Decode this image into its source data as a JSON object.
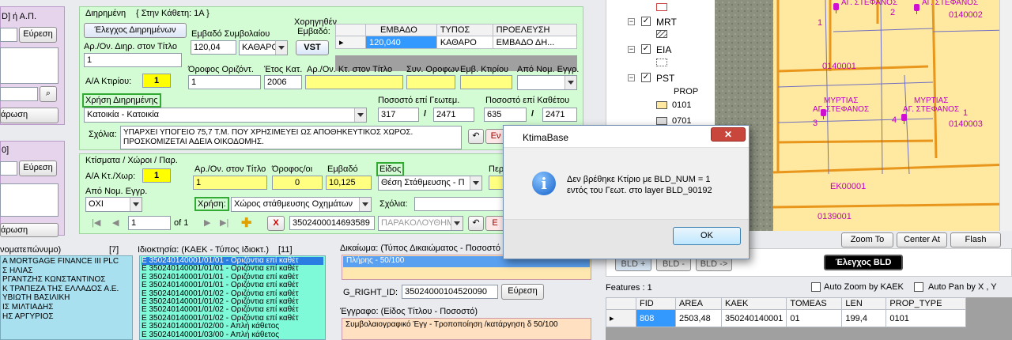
{
  "left": {
    "top_label": "D] ή Α.Π.",
    "search1": "Εύρεση",
    "apply1": "άρωση",
    "bracket": "0]",
    "search2": "Εύρεση",
    "apply2": "άρωση",
    "owners_header": "νοματεπώνυμο)",
    "owners_count": "[7]",
    "owners": [
      "A MORTGAGE FINANCE III PLC",
      "Σ ΗΛΙΑΣ",
      "ΡΓΑΝΤΖΗΣ ΚΩΝΣΤΑΝΤΙΝΟΣ",
      "Κ ΤΡΑΠΕΖΑ ΤΗΣ ΕΛΛΑΔΟΣ Α.Ε.",
      "ΥΒΙΩΤΗ ΒΑΣΙΛΙΚΗ",
      "ΙΣ ΜΙΛΤΙΑΔΗΣ",
      "ΗΣ ΑΡΓΥΡΙΟΣ"
    ]
  },
  "dir": {
    "title": "Διηρημένη",
    "subtitle": "{ Στην Κάθετη: 1Α }",
    "check_btn": "Έλεγχος Διηρημένων",
    "num_label": "Αρ./Ον. Διηρ. στον Τίτλο",
    "num_value": "1",
    "area_label": "Εμβαδό Συμβολαίου",
    "area_value": "120,04",
    "area_type": "ΚΑΘΑΡΟ",
    "granted_label": "Χορηγηθέν Εμβαδό:",
    "vst": "VST",
    "grid_headers": [
      "ΕΜΒΑΔΟ",
      "ΤΥΠΟΣ",
      "ΠΡΟΕΛΕΥΣΗ"
    ],
    "grid_row": [
      "120,040",
      "ΚΑΘΑΡΟ",
      "ΕΜΒΑΔΟ ΔΗ..."
    ],
    "building_label": "Α/Α Κτιρίου:",
    "building_value": "1",
    "floor_label": "Όροφος Οριζόντ.",
    "floor_value": "1",
    "year_label": "Έτος Κατ.",
    "year_value": "2006",
    "ktnum_label": "Αρ./Ον. Κτ. στον Τίτλο",
    "coown_label": "Συν. Οροφων",
    "barea_label": "Εμβ. Κτιρίου",
    "legal_label": "Από Νομ. Εγγρ.",
    "use_label": "Χρήση Διηρημένης",
    "use_value": "Κατοικία - Κατοικία",
    "pct_geo_label": "Ποσοστό επί Γεωτεμ.",
    "pct_geo_a": "317",
    "pct_geo_b": "2471",
    "pct_kath_label": "Ποσοστό επί Καθέτου",
    "pct_kath_a": "635",
    "pct_kath_b": "2471",
    "notes_label": "Σχόλια:",
    "notes_text": "ΥΠΑΡΧΕΙ ΥΠΟΓΕΙΟ 75,7 Τ.Μ. ΠΟΥ ΧΡΗΣΙΜΕΥΕΙ ΩΣ ΑΠΟΘΗΚΕΥΤΙΚΟΣ ΧΩΡΟΣ. ΠΡΟΣΚΟΜΙΖΕΤΑΙ ΑΔΕΙΑ ΟΙΚΟΔΟΜΗΣ.",
    "en_btn": "Εν",
    "slash": "/"
  },
  "kt": {
    "title": "Κτίσματα / Χώροι / Παρ.",
    "aa_label": "Α/Α Κτ./Χωρ:",
    "aa_value": "1",
    "num_label": "Αρ./Ον. στον Τίτλο",
    "num_value": "1",
    "floor_label": "Όροφος/οι",
    "floor_value": "0",
    "area_label": "Εμβαδό",
    "area_value": "10,125",
    "kind_label": "Είδος",
    "kind_value": "Θέση Στάθμευσης - Π",
    "per_label": "Περ",
    "legal_label": "Από Νομ. Εγγρ.",
    "legal_value": "ΟΧΙ",
    "use_label": "Χρήση:",
    "use_value": "Χώρος στάθμευσης Οχημάτων",
    "notes_label": "Σχόλια:",
    "nav_pos": "1",
    "nav_of": "of 1",
    "code": "3502400014693589",
    "status": "ΠΑΡΑΚΟΛΟΥΘΗΜ.",
    "x_btn": "X",
    "e_btn": "Ε"
  },
  "prop": {
    "header": "Ιδιοκτησία: (ΚΑΕΚ - Τύπος Ιδιοκτ.)",
    "count": "[11]",
    "items": [
      "Ε 350240140001/01/01 - Οριζόντια επί καθέτ",
      "Ε 350240140001/01/01 - Οριζόντια επί καθέτ",
      "Ε 350240140001/01/01 - Οριζόντια επί καθέτ",
      "Ε 350240140001/01/01 - Οριζόντια επί καθέτ",
      "Ε 350240140001/01/02 - Οριζόντια επί καθέτ",
      "Ε 350240140001/01/02 - Οριζόντια επί καθέτ",
      "Ε 350240140001/01/02 - Οριζόντια επί καθέτ",
      "Ε 350240140001/01/02 - Οριζόντια επί καθέτ",
      "Ε 350240140001/02/00 - Απλή κάθετος",
      "Ε 350240140001/03/00 - Απλή κάθετος"
    ]
  },
  "rights": {
    "header": "Δικαίωμα: (Τύπος Δικαιώματος - Ποσοστό",
    "item": "Πλήρης - 50/100",
    "gright_label": "G_RIGHT_ID:",
    "gright_value": "35024000104520090",
    "search": "Εύρεση",
    "doc_header": "Έγγραφο: (Είδος Τίτλου - Ποσοστό)",
    "doc_item": "Συμβολαιογραφικό Έγγ - Τροποποίηση /κατάργηση δ 50/100"
  },
  "layers": {
    "items": [
      {
        "name": "MRT",
        "checked": "✓"
      },
      {
        "name": "EIA",
        "checked": "✓"
      },
      {
        "name": "PST",
        "checked": "✓"
      }
    ],
    "prop_label": "PROP",
    "legend": [
      "0101",
      "0701"
    ]
  },
  "map": {
    "labels": [
      "0140002",
      "0140001",
      "0140003",
      "ΕΚ00001",
      "0139001"
    ],
    "poi": [
      "ΜΥΡΤΙΑΣ",
      "ΑΓ. ΣΤΕΦΑΝΟΣ",
      "ΜΥΡΤΙΑΣ",
      "ΑΓ. ΣΤΕΦΑΝΟΣ",
      "ΑΓ. ΣΤΕΦΑΝΟΣ",
      "ΑΓ. ΣΤΕΦΑΝΟΣ"
    ],
    "nums": [
      "1",
      "2",
      "3",
      "3",
      "4",
      "1"
    ]
  },
  "maptools": {
    "zoom_to": "Zoom To",
    "center_at": "Center At",
    "flash": "Flash",
    "bld_plus": "BLD +",
    "bld_minus": "BLD -",
    "bld_arrow": "BLD ->",
    "check_bld": "Έλεγχος BLD",
    "features": "Features : 1",
    "auto_zoom": "Auto Zoom by ΚΑΕΚ",
    "auto_pan": "Auto Pan by X , Y",
    "grid_headers": [
      "FID",
      "AREA",
      "KAEK",
      "TOMEAS",
      "LEN",
      "PROP_TYPE"
    ],
    "grid_row": [
      "808",
      "2503,48",
      "350240140001",
      "01",
      "199,4",
      "0101"
    ]
  },
  "dialog": {
    "title": "KtimaBase",
    "line1": "Δεν βρέθηκε Κτίριο με BLD_NUM = 1",
    "line2": "εντός του Γεωτ. στο layer BLD_90192",
    "ok": "OK"
  },
  "colors": {
    "green_panel": "#d4fcd4",
    "map_parcel": "#ffe8a0",
    "dialog_bg": "#f0f0f0"
  }
}
